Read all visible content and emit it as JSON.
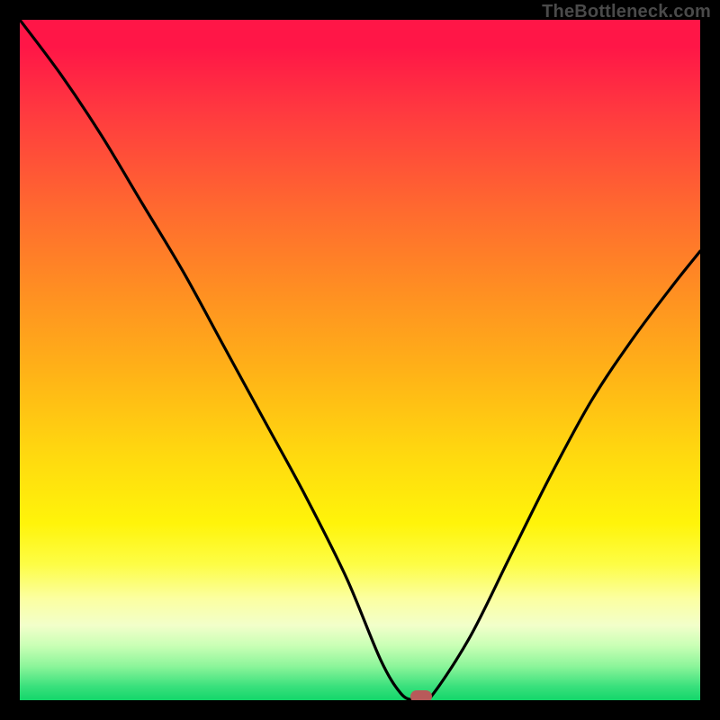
{
  "watermark": "TheBottleneck.com",
  "chart_data": {
    "type": "line",
    "title": "",
    "xlabel": "",
    "ylabel": "",
    "xlim": [
      0,
      100
    ],
    "ylim": [
      0,
      100
    ],
    "grid": false,
    "legend": false,
    "series": [
      {
        "name": "bottleneck-curve",
        "x": [
          0,
          6,
          12,
          18,
          24,
          30,
          36,
          42,
          48,
          53,
          56,
          58,
          60,
          66,
          72,
          78,
          84,
          90,
          96,
          100
        ],
        "y": [
          100,
          92,
          83,
          73,
          63,
          52,
          41,
          30,
          18,
          6,
          1,
          0,
          0,
          9,
          21,
          33,
          44,
          53,
          61,
          66
        ]
      }
    ],
    "marker": {
      "x": 59,
      "y": 0.5,
      "color": "#b85a5a"
    },
    "background_gradient": {
      "top": "#ff1647",
      "bottom": "#13d66a",
      "meaning": "red=high bottleneck, green=low bottleneck"
    }
  }
}
